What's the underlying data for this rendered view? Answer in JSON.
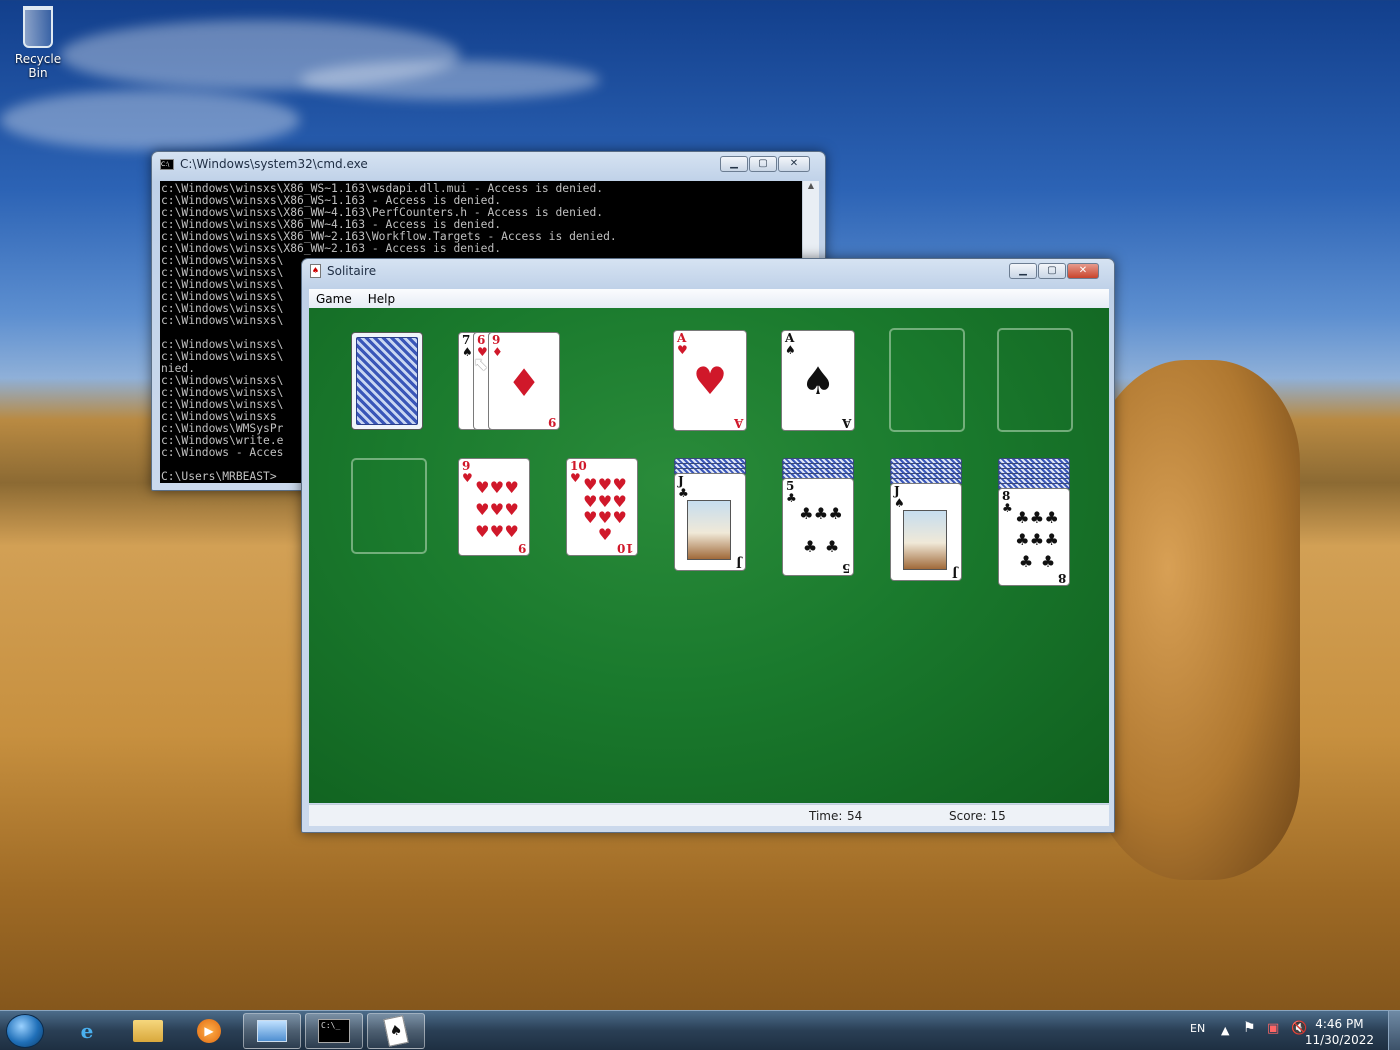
{
  "desktop": {
    "recycle_label": "Recycle Bin"
  },
  "cmd": {
    "title": "C:\\Windows\\system32\\cmd.exe",
    "lines": [
      "c:\\Windows\\winsxs\\X86_WS~1.163\\wsdapi.dll.mui - Access is denied.",
      "c:\\Windows\\winsxs\\X86_WS~1.163 - Access is denied.",
      "c:\\Windows\\winsxs\\X86_WW~4.163\\PerfCounters.h - Access is denied.",
      "c:\\Windows\\winsxs\\X86_WW~4.163 - Access is denied.",
      "c:\\Windows\\winsxs\\X86_WW~2.163\\Workflow.Targets - Access is denied.",
      "c:\\Windows\\winsxs\\X86_WW~2.163 - Access is denied.",
      "c:\\Windows\\winsxs\\",
      "c:\\Windows\\winsxs\\",
      "c:\\Windows\\winsxs\\",
      "c:\\Windows\\winsxs\\",
      "c:\\Windows\\winsxs\\",
      "c:\\Windows\\winsxs\\",
      "",
      "c:\\Windows\\winsxs\\",
      "c:\\Windows\\winsxs\\",
      "nied.",
      "c:\\Windows\\winsxs\\",
      "c:\\Windows\\winsxs\\",
      "c:\\Windows\\winsxs\\",
      "c:\\Windows\\winsxs",
      "c:\\Windows\\WMSysPr",
      "c:\\Windows\\write.e",
      "c:\\Windows - Acces",
      "",
      "C:\\Users\\MRBEAST>"
    ]
  },
  "solitaire": {
    "title": "Solitaire",
    "menu": {
      "game": "Game",
      "help": "Help"
    },
    "status": {
      "time_label": "Time:",
      "time_value": "54",
      "score_label": "Score: 15"
    },
    "waste": [
      {
        "rank": "7",
        "suit": "♠",
        "color": "blk"
      },
      {
        "rank": "6",
        "suit": "♥",
        "color": "red"
      },
      {
        "rank": "9",
        "suit": "♦",
        "color": "red"
      }
    ],
    "foundations": [
      {
        "rank": "A",
        "suit": "♥",
        "color": "red"
      },
      {
        "rank": "A",
        "suit": "♠",
        "color": "blk"
      },
      null,
      null
    ],
    "tableau": [
      {
        "hidden": 0,
        "top": null
      },
      {
        "hidden": 0,
        "top": {
          "rank": "9",
          "suit": "♥",
          "color": "red",
          "pips": 9
        }
      },
      {
        "hidden": 0,
        "top": {
          "rank": "10",
          "suit": "♥",
          "color": "red",
          "pips": 10
        }
      },
      {
        "hidden": 3,
        "top": {
          "rank": "J",
          "suit": "♣",
          "color": "blk",
          "face": true
        }
      },
      {
        "hidden": 4,
        "top": {
          "rank": "5",
          "suit": "♣",
          "color": "blk",
          "pips": 5
        }
      },
      {
        "hidden": 5,
        "top": {
          "rank": "J",
          "suit": "♠",
          "color": "blk",
          "face": true
        }
      },
      {
        "hidden": 6,
        "top": {
          "rank": "8",
          "suit": "♣",
          "color": "blk",
          "pips": 8
        }
      }
    ]
  },
  "taskbar": {
    "lang": "EN",
    "time": "4:46 PM",
    "date": "11/30/2022",
    "buttons": [
      "ie-icon",
      "explorer-icon",
      "media-player-icon",
      "control-panel-icon",
      "cmd-icon",
      "solitaire-icon"
    ]
  }
}
